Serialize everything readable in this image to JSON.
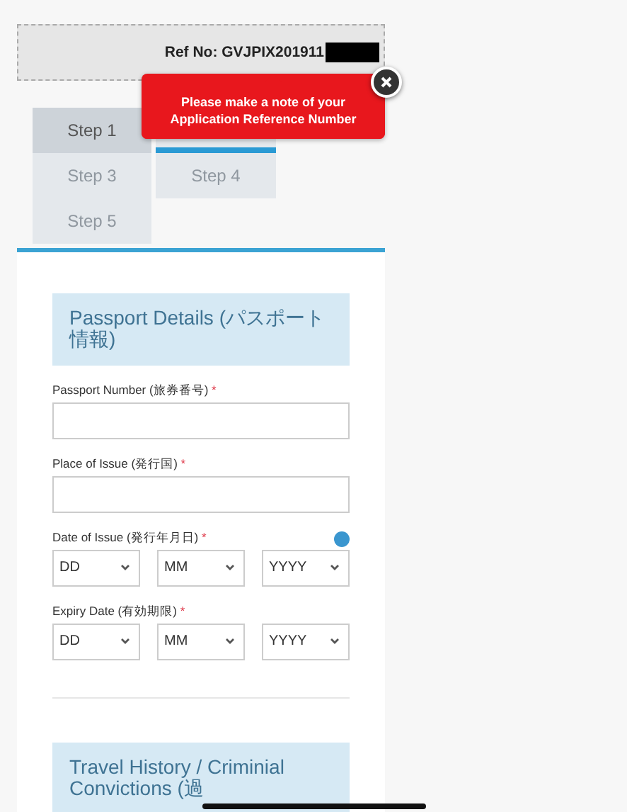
{
  "reference": {
    "label": "Ref No: GVJPIX201911",
    "redacted": true
  },
  "tooltip": {
    "message": "Please make a note of your Application Reference Number"
  },
  "steps": [
    {
      "label": "Step 1",
      "selected": true,
      "disabled": false
    },
    {
      "selected": false,
      "disabled": false,
      "current": true
    },
    {
      "label": "Step 3",
      "selected": false,
      "disabled": true
    },
    {
      "label": "Step 4",
      "selected": false,
      "disabled": true
    },
    {
      "label": "Step 5",
      "selected": false,
      "disabled": true
    }
  ],
  "sections": [
    {
      "title": "Passport Details (パスポート情報)",
      "fields": [
        {
          "kind": "text",
          "label": "Passport Number (旅券番号)",
          "required": "*"
        },
        {
          "kind": "text",
          "label": "Place of Issue (発行国)",
          "required": "*"
        },
        {
          "kind": "date",
          "label": "Date of Issue (発行年月日)",
          "required": "*",
          "help": true,
          "parts": [
            "DD",
            "MM",
            "YYYY"
          ]
        },
        {
          "kind": "date",
          "label": "Expiry Date (有効期限)",
          "required": "*",
          "parts": [
            "DD",
            "MM",
            "YYYY"
          ]
        }
      ]
    },
    {
      "title": "Travel History / Criminial Convictions (過"
    }
  ]
}
